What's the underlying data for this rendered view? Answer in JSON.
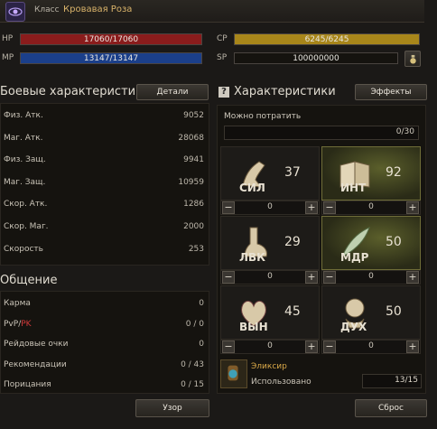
{
  "header": {
    "class_label": "Класс",
    "class_name": "Кровавая Роза"
  },
  "bars": {
    "hp": {
      "label": "HP",
      "text": "17060/17060",
      "color": "#8a1c1c"
    },
    "mp": {
      "label": "MP",
      "text": "13147/13147",
      "color": "#1b3f8a"
    },
    "cp": {
      "label": "CP",
      "text": "6245/6245",
      "color": "#a8861a"
    },
    "sp": {
      "label": "SP",
      "text": "100000000"
    }
  },
  "combat": {
    "title": "Боевые характеристики",
    "details_button": "Детали",
    "rows": [
      {
        "label": "Физ. Атк.",
        "value": "9052"
      },
      {
        "label": "Маг. Атк.",
        "value": "28068"
      },
      {
        "label": "Физ. Защ.",
        "value": "9941"
      },
      {
        "label": "Маг. Защ.",
        "value": "10959"
      },
      {
        "label": "Скор. Атк.",
        "value": "1286"
      },
      {
        "label": "Скор. Маг.",
        "value": "2000"
      },
      {
        "label": "Скорость",
        "value": "253"
      }
    ]
  },
  "social": {
    "title": "Общение",
    "rows": [
      {
        "label": "Карма",
        "value": "0"
      },
      {
        "label_pvp": "PvP",
        "label_sep": "/",
        "label_pk": "PK",
        "value": "0 / 0"
      },
      {
        "label": "Рейдовые очки",
        "value": "0"
      },
      {
        "label": "Рекомендации",
        "value": "0 / 43"
      },
      {
        "label": "Порицания",
        "value": "0 / 15"
      }
    ]
  },
  "characteristics": {
    "help_icon": "?",
    "title": "Характеристики",
    "effects_button": "Эффекты",
    "spend_label": "Можно потратить",
    "spend_value": "0/30",
    "stats": [
      {
        "name": "СИЛ",
        "value": "37",
        "add": "0",
        "icon": "arm-icon"
      },
      {
        "name": "ИНТ",
        "value": "92",
        "add": "0",
        "icon": "book-icon"
      },
      {
        "name": "ЛВК",
        "value": "29",
        "add": "0",
        "icon": "foot-icon"
      },
      {
        "name": "МДР",
        "value": "50",
        "add": "0",
        "icon": "feather-icon"
      },
      {
        "name": "ВЫН",
        "value": "45",
        "add": "0",
        "icon": "heart-icon"
      },
      {
        "name": "ДУХ",
        "value": "50",
        "add": "0",
        "icon": "spirit-icon"
      }
    ]
  },
  "elixir": {
    "title": "Эликсир",
    "used_label": "Использовано",
    "used_value": "13/15"
  },
  "footer": {
    "pattern_button": "Узор",
    "reset_button": "Сброс"
  }
}
